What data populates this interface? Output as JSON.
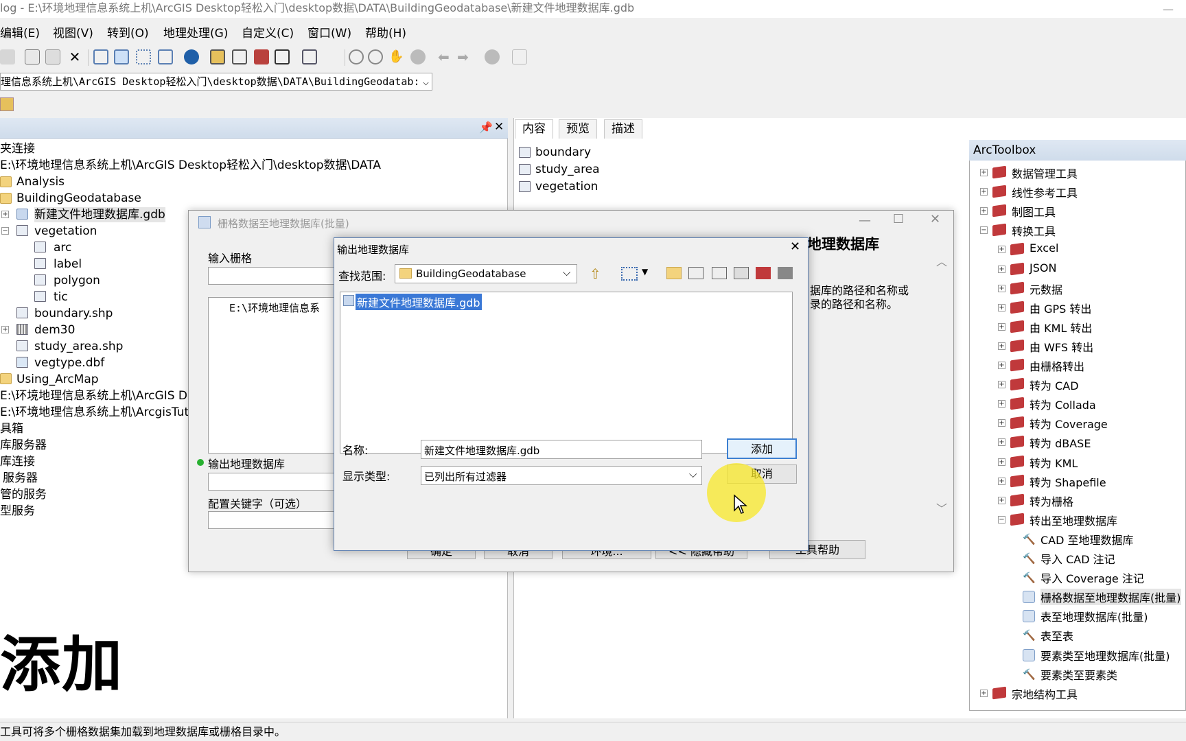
{
  "window": {
    "title": "log - E:\\环境地理信息系统上机\\ArcGIS Desktop轻松入门\\desktop数据\\DATA\\BuildingGeodatabase\\新建文件地理数据库.gdb",
    "min": "—"
  },
  "menu": [
    "编辑(E)",
    "视图(V)",
    "转到(O)",
    "地理处理(G)",
    "自定义(C)",
    "窗口(W)",
    "帮助(H)"
  ],
  "location_path": "理信息系统上机\\ArcGIS Desktop轻松入门\\desktop数据\\DATA\\BuildingGeodatab:",
  "catalog": {
    "pin": "ꟸ",
    "close": "✕",
    "items": [
      {
        "label": "夹连接"
      },
      {
        "label": "E:\\环境地理信息系统上机\\ArcGIS Desktop轻松入门\\desktop数据\\DATA"
      },
      {
        "label": "Analysis"
      },
      {
        "label": "BuildingGeodatabase"
      },
      {
        "label": "新建文件地理数据库.gdb"
      },
      {
        "label": "vegetation"
      },
      {
        "label": "arc"
      },
      {
        "label": "label"
      },
      {
        "label": "polygon"
      },
      {
        "label": "tic"
      },
      {
        "label": "boundary.shp"
      },
      {
        "label": "dem30"
      },
      {
        "label": "study_area.shp"
      },
      {
        "label": "vegtype.dbf"
      },
      {
        "label": "Using_ArcMap"
      },
      {
        "label": "E:\\环境地理信息系统上机\\ArcGIS De"
      },
      {
        "label": "E:\\环境地理信息系统上机\\ArcgisTut"
      },
      {
        "label": "具箱"
      },
      {
        "label": "库服务器"
      },
      {
        "label": "库连接"
      },
      {
        "label": "服务器"
      },
      {
        "label": "管的服务"
      },
      {
        "label": "型服务"
      }
    ]
  },
  "contents": {
    "tabs": [
      "内容",
      "预览",
      "描述"
    ],
    "items": [
      "boundary",
      "study_area",
      "vegetation"
    ]
  },
  "toolbox": {
    "title": "ArcToolbox",
    "items": [
      "数据管理工具",
      "线性参考工具",
      "制图工具",
      "转换工具",
      "Excel",
      "JSON",
      "元数据",
      "由 GPS 转出",
      "由 KML 转出",
      "由 WFS 转出",
      "由栅格转出",
      "转为 CAD",
      "转为 Collada",
      "转为 Coverage",
      "转为 dBASE",
      "转为 KML",
      "转为 Shapefile",
      "转为栅格",
      "转出至地理数据库",
      "CAD 至地理数据库",
      "导入 CAD 注记",
      "导入 Coverage 注记",
      "栅格数据至地理数据库(批量)",
      "表至地理数据库(批量)",
      "表至表",
      "要素类至地理数据库(批量)",
      "要素类至要素类",
      "宗地结构工具"
    ]
  },
  "batch_dialog": {
    "title": "栅格数据至地理数据库(批量)",
    "input_label": "输入栅格",
    "list_first": "E:\\环境地理信息系",
    "output_label": "输出地理数据库",
    "keyword_label": "配置关键字（可选）",
    "buttons": [
      "确定",
      "取消",
      "环境...",
      "<< 隐藏帮助",
      "工具帮助"
    ],
    "help_title": "地理数据库",
    "help_text1": "据库的路径和名称或",
    "help_text2": "录的路径和名称。"
  },
  "out_dialog": {
    "title": "输出地理数据库",
    "lookin_label": "查找范围:",
    "lookin_value": "BuildingGeodatabase",
    "selected_item": "新建文件地理数据库.gdb",
    "name_label": "名称:",
    "name_value": "新建文件地理数据库.gdb",
    "type_label": "显示类型:",
    "type_value": "已列出所有过滤器",
    "add_button": "添加",
    "cancel_button": "取消"
  },
  "caption": "添加",
  "status": "工具可将多个栅格数据集加载到地理数据库或栅格目录中。",
  "colors": {
    "selection": "#3a78d6",
    "accent": "#c0393b",
    "highlight": "#f8e828"
  }
}
